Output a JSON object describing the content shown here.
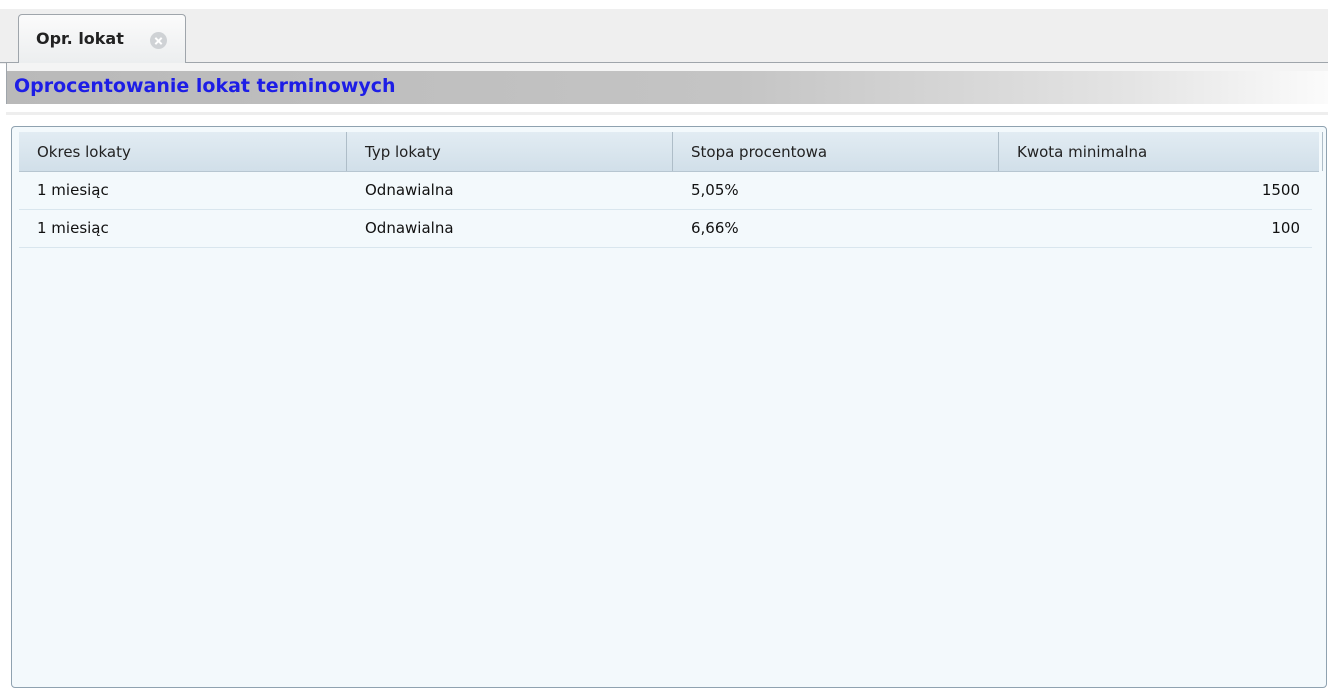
{
  "tabs": [
    {
      "label": "Opr. lokat",
      "close_icon": "close-circle-icon"
    }
  ],
  "panel": {
    "title": "Oprocentowanie lokat terminowych"
  },
  "table": {
    "columns": [
      "Okres lokaty",
      "Typ lokaty",
      "Stopa procentowa",
      "Kwota minimalna"
    ],
    "rows": [
      [
        "1 miesiąc",
        "Odnawialna",
        "5,05%",
        "1500"
      ],
      [
        "1 miesiąc",
        "Odnawialna",
        "6,66%",
        "100"
      ]
    ]
  },
  "colors": {
    "title": "#1d1de6",
    "grid_bg": "#f3f9fc",
    "header_bg": "#d6e3ec"
  }
}
